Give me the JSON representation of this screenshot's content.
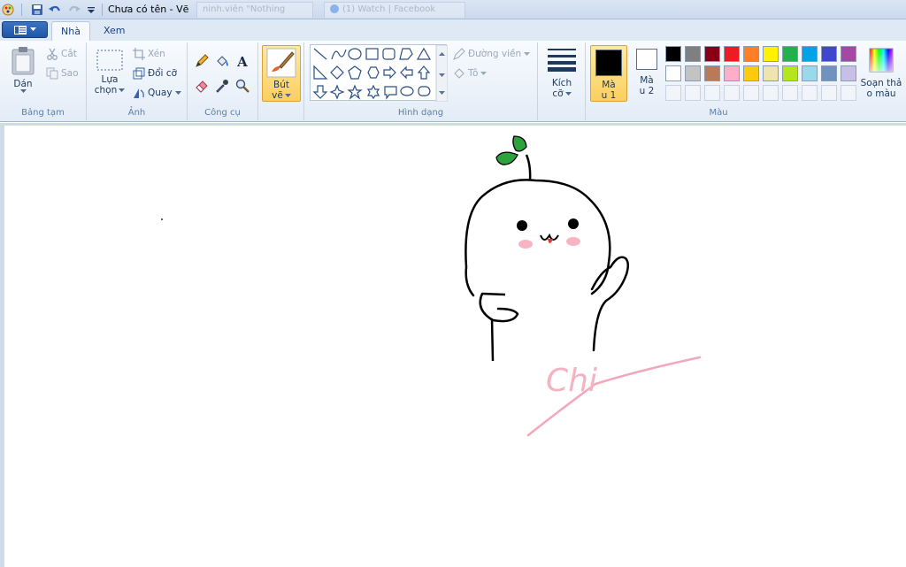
{
  "window": {
    "title": "Chưa có tên - Vẽ",
    "bg_tabs": [
      "ninh.viên \"Nothing",
      "(1) Watch | Facebook"
    ]
  },
  "tabs": [
    {
      "label": "Nhà",
      "active": true
    },
    {
      "label": "Xem",
      "active": false
    }
  ],
  "groups": {
    "clipboard": {
      "label": "Bảng tạm",
      "paste": "Dán",
      "cut": "Cắt",
      "copy": "Sao"
    },
    "image": {
      "label": "Ảnh",
      "select_line1": "Lựa",
      "select_line2": "chọn",
      "crop": "Xén",
      "resize": "Đổi cỡ",
      "rotate": "Quay"
    },
    "tools": {
      "label": "Công cụ",
      "brush_line1": "Bút",
      "brush_line2": "vẽ"
    },
    "shapes": {
      "label": "Hình dạng",
      "outline": "Đường viền",
      "fill": "Tô"
    },
    "size": {
      "label_line1": "Kích",
      "label_line2": "cỡ"
    },
    "colors": {
      "label": "Màu",
      "color1_line1": "Mà",
      "color1_line2": "u 1",
      "color2_line1": "Mà",
      "color2_line2": "u 2",
      "edit_line1": "Soạn thả",
      "edit_line2": "o màu",
      "color1_value": "#000000",
      "color2_value": "#ffffff",
      "palette_row1": [
        "#000000",
        "#7f7f7f",
        "#880015",
        "#ed1c24",
        "#ff7f27",
        "#fff200",
        "#22b14c",
        "#00a2e8",
        "#3f48cc",
        "#a349a4"
      ],
      "palette_row2": [
        "#ffffff",
        "#c3c3c3",
        "#b97a57",
        "#ffaec9",
        "#ffc90e",
        "#efe4b0",
        "#b5e61d",
        "#99d9ea",
        "#7092be",
        "#c8bfe7"
      ]
    }
  },
  "canvas": {
    "handwritten_text": "Chi"
  }
}
